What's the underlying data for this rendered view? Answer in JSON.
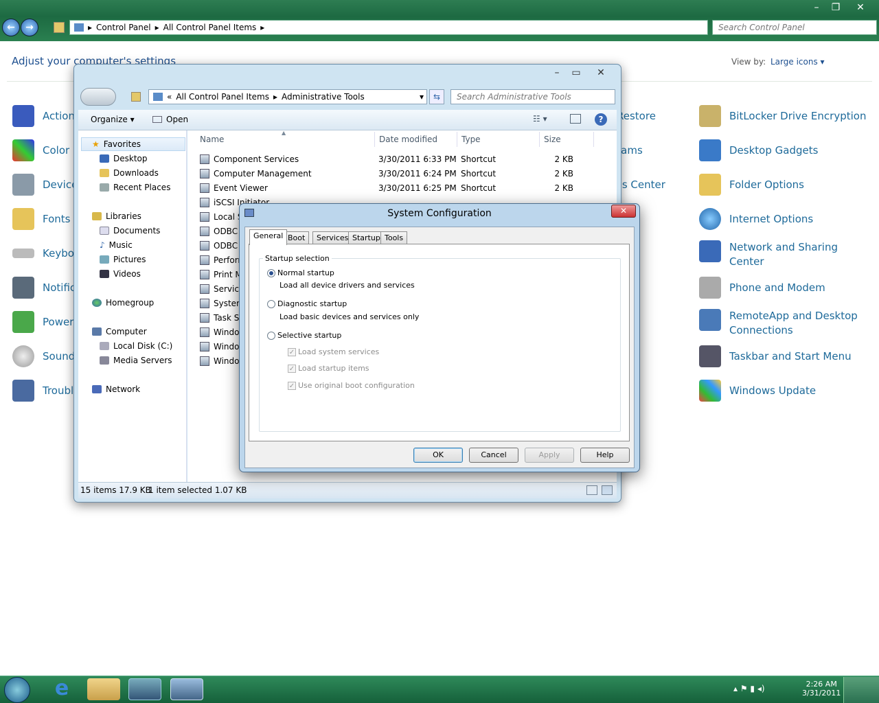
{
  "control_panel": {
    "address": [
      "Control Panel",
      "All Control Panel Items"
    ],
    "search_placeholder": "Search Control Panel",
    "heading": "Adjust your computer's settings",
    "view_by_label": "View by:",
    "view_by_value": "Large icons",
    "left_items": [
      "Action C",
      "Color M",
      "Device",
      "Fonts",
      "Keyboa",
      "Notifica",
      "Power O",
      "Sound",
      "Trouble"
    ],
    "middle_items": [
      "Restore",
      "rams",
      "ss Center"
    ],
    "right_items": [
      "BitLocker Drive Encryption",
      "Desktop Gadgets",
      "Folder Options",
      "Internet Options",
      "Network and Sharing",
      "Center",
      "Phone and Modem",
      "RemoteApp and Desktop",
      "Connections",
      "Taskbar and Start Menu",
      "Windows Update"
    ]
  },
  "explorer": {
    "address_prefix": "«",
    "address": [
      "All Control Panel Items",
      "Administrative Tools"
    ],
    "search_placeholder": "Search Administrative Tools",
    "organize": "Organize",
    "open": "Open",
    "nav": {
      "favorites": "Favorites",
      "desktop": "Desktop",
      "downloads": "Downloads",
      "recent": "Recent Places",
      "libraries": "Libraries",
      "documents": "Documents",
      "music": "Music",
      "pictures": "Pictures",
      "videos": "Videos",
      "homegroup": "Homegroup",
      "computer": "Computer",
      "local_disk": "Local Disk (C:)",
      "media_servers": "Media Servers",
      "network": "Network"
    },
    "columns": [
      "Name",
      "Date modified",
      "Type",
      "Size"
    ],
    "files": [
      {
        "name": "Component Services",
        "date": "3/30/2011 6:33 PM",
        "type": "Shortcut",
        "size": "2 KB"
      },
      {
        "name": "Computer Management",
        "date": "3/30/2011 6:24 PM",
        "type": "Shortcut",
        "size": "2 KB"
      },
      {
        "name": "Event Viewer",
        "date": "3/30/2011 6:25 PM",
        "type": "Shortcut",
        "size": "2 KB"
      },
      {
        "name": "iSCSI Initiator",
        "date": "",
        "type": "",
        "size": ""
      },
      {
        "name": "Local S",
        "date": "",
        "type": "",
        "size": ""
      },
      {
        "name": "ODBC D",
        "date": "",
        "type": "",
        "size": ""
      },
      {
        "name": "ODBC D",
        "date": "",
        "type": "",
        "size": ""
      },
      {
        "name": "Perform",
        "date": "",
        "type": "",
        "size": ""
      },
      {
        "name": "Print M",
        "date": "",
        "type": "",
        "size": ""
      },
      {
        "name": "Services",
        "date": "",
        "type": "",
        "size": ""
      },
      {
        "name": "System",
        "date": "",
        "type": "",
        "size": ""
      },
      {
        "name": "Task Sch",
        "date": "",
        "type": "",
        "size": ""
      },
      {
        "name": "Window",
        "date": "",
        "type": "",
        "size": ""
      },
      {
        "name": "Window",
        "date": "",
        "type": "",
        "size": ""
      },
      {
        "name": "Window",
        "date": "",
        "type": "",
        "size": ""
      }
    ],
    "status_items": "15 items  17.9 KB",
    "status_selected": "1 item selected  1.07 KB"
  },
  "dialog": {
    "title": "System Configuration",
    "tabs": [
      "General",
      "Boot",
      "Services",
      "Startup",
      "Tools"
    ],
    "group_label": "Startup selection",
    "normal": "Normal startup",
    "normal_desc": "Load all device drivers and services",
    "diagnostic": "Diagnostic startup",
    "diagnostic_desc": "Load basic devices and services only",
    "selective": "Selective startup",
    "load_system": "Load system services",
    "load_startup": "Load startup items",
    "use_boot": "Use original boot configuration",
    "ok": "OK",
    "cancel": "Cancel",
    "apply": "Apply",
    "help": "Help"
  },
  "taskbar": {
    "time": "2:26 AM",
    "date": "3/31/2011"
  }
}
